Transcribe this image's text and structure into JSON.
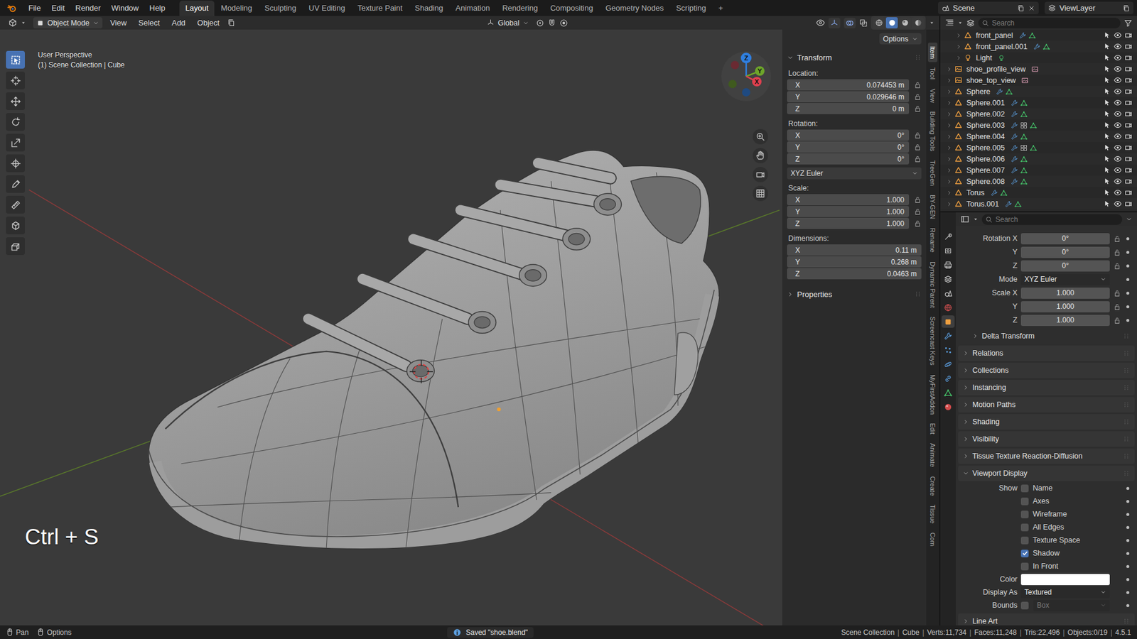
{
  "top_bar": {
    "menu": [
      "File",
      "Edit",
      "Render",
      "Window",
      "Help"
    ],
    "workspaces": [
      {
        "label": "Layout",
        "selected": true
      },
      {
        "label": "Modeling",
        "selected": false
      },
      {
        "label": "Sculpting",
        "selected": false
      },
      {
        "label": "UV Editing",
        "selected": false
      },
      {
        "label": "Texture Paint",
        "selected": false
      },
      {
        "label": "Shading",
        "selected": false
      },
      {
        "label": "Animation",
        "selected": false
      },
      {
        "label": "Rendering",
        "selected": false
      },
      {
        "label": "Compositing",
        "selected": false
      },
      {
        "label": "Geometry Nodes",
        "selected": false
      },
      {
        "label": "Scripting",
        "selected": false
      }
    ],
    "add_tab": "+",
    "scene": "Scene",
    "view_layer": "ViewLayer"
  },
  "viewport_header": {
    "mode": "Object Mode",
    "menus": [
      "View",
      "Select",
      "Add",
      "Object"
    ],
    "orientation": "Global",
    "options": "Options",
    "shading": [
      {
        "kind": "wireframe",
        "selected": false
      },
      {
        "kind": "solid",
        "selected": true
      },
      {
        "kind": "material",
        "selected": false
      },
      {
        "kind": "rendered",
        "selected": false
      }
    ]
  },
  "viewport": {
    "perspective": "User Perspective",
    "context": "(1) Scene Collection | Cube",
    "key_hint": "Ctrl + S",
    "tools": [
      {
        "kind": "select",
        "selected": true
      },
      {
        "kind": "cursor",
        "selected": false
      },
      {
        "kind": "move",
        "selected": false
      },
      {
        "kind": "rotate",
        "selected": false
      },
      {
        "kind": "scale",
        "selected": false
      },
      {
        "kind": "transform",
        "selected": false
      },
      {
        "kind": "annotate",
        "selected": false
      },
      {
        "kind": "measure",
        "selected": false
      },
      {
        "kind": "addcube",
        "selected": false
      },
      {
        "kind": "extrude",
        "selected": false
      }
    ],
    "gizmo": [
      {
        "axis": "Z",
        "color": "#2f7fe0"
      },
      {
        "axis": "Y",
        "color": "#6ea52a"
      },
      {
        "axis": "X",
        "color": "#e0404f"
      }
    ]
  },
  "sidebar": {
    "title": "Transform",
    "sections": [
      {
        "label": "Location:",
        "lock": true,
        "fields": [
          {
            "axis": "X",
            "value": "0.074453 m"
          },
          {
            "axis": "Y",
            "value": "0.029646 m"
          },
          {
            "axis": "Z",
            "value": "0 m"
          }
        ]
      },
      {
        "label": "Rotation:",
        "lock": true,
        "mode": "XYZ Euler",
        "fields": [
          {
            "axis": "X",
            "value": "0°"
          },
          {
            "axis": "Y",
            "value": "0°"
          },
          {
            "axis": "Z",
            "value": "0°"
          }
        ]
      },
      {
        "label": "Scale:",
        "lock": true,
        "fields": [
          {
            "axis": "X",
            "value": "1.000"
          },
          {
            "axis": "Y",
            "value": "1.000"
          },
          {
            "axis": "Z",
            "value": "1.000"
          }
        ]
      },
      {
        "label": "Dimensions:",
        "lock": false,
        "fields": [
          {
            "axis": "X",
            "value": "0.11 m"
          },
          {
            "axis": "Y",
            "value": "0.268 m"
          },
          {
            "axis": "Z",
            "value": "0.0463 m"
          }
        ]
      }
    ],
    "properties": "Properties",
    "tabs": [
      {
        "label": "Item",
        "selected": true
      },
      {
        "label": "Tool",
        "selected": false
      },
      {
        "label": "View",
        "selected": false
      },
      {
        "label": "Building Tools",
        "selected": false
      },
      {
        "label": "TreeGen",
        "selected": false
      },
      {
        "label": "BY-GEN",
        "selected": false
      },
      {
        "label": "Rename",
        "selected": false
      },
      {
        "label": "Dynamic Parent",
        "selected": false
      },
      {
        "label": "Screencast Keys",
        "selected": false
      },
      {
        "label": "MyFirstAddon",
        "selected": false
      },
      {
        "label": "Edit",
        "selected": false
      },
      {
        "label": "Animate",
        "selected": false
      },
      {
        "label": "Create",
        "selected": false
      },
      {
        "label": "Tissue",
        "selected": false
      },
      {
        "label": "Com",
        "selected": false
      }
    ]
  },
  "outliner": {
    "search_placeholder": "Search",
    "rows": [
      {
        "name": "front_panel",
        "kind": "mesh",
        "level": 1,
        "modifier": true,
        "extra": false
      },
      {
        "name": "front_panel.001",
        "kind": "mesh",
        "level": 1,
        "modifier": true,
        "extra": false
      },
      {
        "name": "Light",
        "kind": "light",
        "level": 1,
        "modifier": false,
        "extra": false
      },
      {
        "name": "shoe_profile_view",
        "kind": "image",
        "level": 0,
        "modifier": false,
        "extra": false
      },
      {
        "name": "shoe_top_view",
        "kind": "image",
        "level": 0,
        "modifier": false,
        "extra": false
      },
      {
        "name": "Sphere",
        "kind": "mesh",
        "level": 0,
        "modifier": true,
        "extra": false
      },
      {
        "name": "Sphere.001",
        "kind": "mesh",
        "level": 0,
        "modifier": true,
        "extra": false
      },
      {
        "name": "Sphere.002",
        "kind": "mesh",
        "level": 0,
        "modifier": true,
        "extra": false
      },
      {
        "name": "Sphere.003",
        "kind": "mesh",
        "level": 0,
        "modifier": true,
        "extra": true
      },
      {
        "name": "Sphere.004",
        "kind": "mesh",
        "level": 0,
        "modifier": true,
        "extra": false
      },
      {
        "name": "Sphere.005",
        "kind": "mesh",
        "level": 0,
        "modifier": true,
        "extra": true
      },
      {
        "name": "Sphere.006",
        "kind": "mesh",
        "level": 0,
        "modifier": true,
        "extra": false
      },
      {
        "name": "Sphere.007",
        "kind": "mesh",
        "level": 0,
        "modifier": true,
        "extra": false
      },
      {
        "name": "Sphere.008",
        "kind": "mesh",
        "level": 0,
        "modifier": true,
        "extra": false
      },
      {
        "name": "Torus",
        "kind": "mesh",
        "level": 0,
        "modifier": true,
        "extra": false
      },
      {
        "name": "Torus.001",
        "kind": "mesh",
        "level": 0,
        "modifier": true,
        "extra": false
      }
    ]
  },
  "properties": {
    "search_placeholder": "Search",
    "tabs": [
      {
        "kind": "tool",
        "selected": false,
        "color": "#c8c8c8"
      },
      {
        "kind": "render",
        "selected": false,
        "color": "#c8c8c8"
      },
      {
        "kind": "output",
        "selected": false,
        "color": "#c8c8c8"
      },
      {
        "kind": "view_layer",
        "selected": false,
        "color": "#c8c8c8"
      },
      {
        "kind": "scene",
        "selected": false,
        "color": "#c8c8c8"
      },
      {
        "kind": "world",
        "selected": false,
        "color": "#d65050"
      },
      {
        "kind": "object",
        "selected": true,
        "color": "#f0a040"
      },
      {
        "kind": "modifiers",
        "selected": false,
        "color": "#5c9fe0"
      },
      {
        "kind": "particles",
        "selected": false,
        "color": "#5c9fe0"
      },
      {
        "kind": "physics",
        "selected": false,
        "color": "#5c9fe0"
      },
      {
        "kind": "constraints",
        "selected": false,
        "color": "#5c9fe0"
      },
      {
        "kind": "data",
        "selected": false,
        "color": "#45c46a"
      },
      {
        "kind": "material",
        "selected": false,
        "color": "#d24a4a"
      }
    ],
    "fields": [
      {
        "label": "Rotation X",
        "value": "0°",
        "kind": "number",
        "lock": true
      },
      {
        "label": "Y",
        "value": "0°",
        "kind": "number",
        "lock": true
      },
      {
        "label": "Z",
        "value": "0°",
        "kind": "number",
        "lock": true
      },
      {
        "label": "Mode",
        "value": "XYZ Euler",
        "kind": "dropdown",
        "lock": false
      },
      {
        "label": "Scale X",
        "value": "1.000",
        "kind": "number",
        "lock": true
      },
      {
        "label": "Y",
        "value": "1.000",
        "kind": "number",
        "lock": true
      },
      {
        "label": "Z",
        "value": "1.000",
        "kind": "number",
        "lock": true
      }
    ],
    "panels": [
      {
        "label": "Delta Transform",
        "expanded": false,
        "sub": true
      },
      {
        "label": "Relations",
        "expanded": false,
        "sub": false
      },
      {
        "label": "Collections",
        "expanded": false,
        "sub": false
      },
      {
        "label": "Instancing",
        "expanded": false,
        "sub": false
      },
      {
        "label": "Motion Paths",
        "expanded": false,
        "sub": false
      },
      {
        "label": "Shading",
        "expanded": false,
        "sub": false
      },
      {
        "label": "Visibility",
        "expanded": false,
        "sub": false
      },
      {
        "label": "Tissue Texture Reaction-Diffusion",
        "expanded": false,
        "sub": false
      }
    ],
    "viewport_display": {
      "label": "Viewport Display",
      "expanded": true,
      "show_label": "Show",
      "show": [
        {
          "label": "Name",
          "checked": false
        },
        {
          "label": "Axes",
          "checked": false
        },
        {
          "label": "Wireframe",
          "checked": false
        },
        {
          "label": "All Edges",
          "checked": false
        },
        {
          "label": "Texture Space",
          "checked": false
        },
        {
          "label": "Shadow",
          "checked": true
        },
        {
          "label": "In Front",
          "checked": false
        }
      ],
      "color_label": "Color",
      "color": "#ffffff",
      "display_as_label": "Display As",
      "display_as": "Textured",
      "bounds_label": "Bounds",
      "bounds": false,
      "bounds_type": "Box"
    },
    "after_panels": [
      {
        "label": "Line Art",
        "expanded": false
      }
    ]
  },
  "status_bar": {
    "hints": [
      "Pan",
      "Options"
    ],
    "message": "Saved \"shoe.blend\"",
    "separator": "|",
    "info": [
      "Scene Collection",
      "Cube",
      "Verts:11,734",
      "Faces:11,248",
      "Tris:22,496",
      "Objects:0/19",
      "4.5.1"
    ]
  }
}
